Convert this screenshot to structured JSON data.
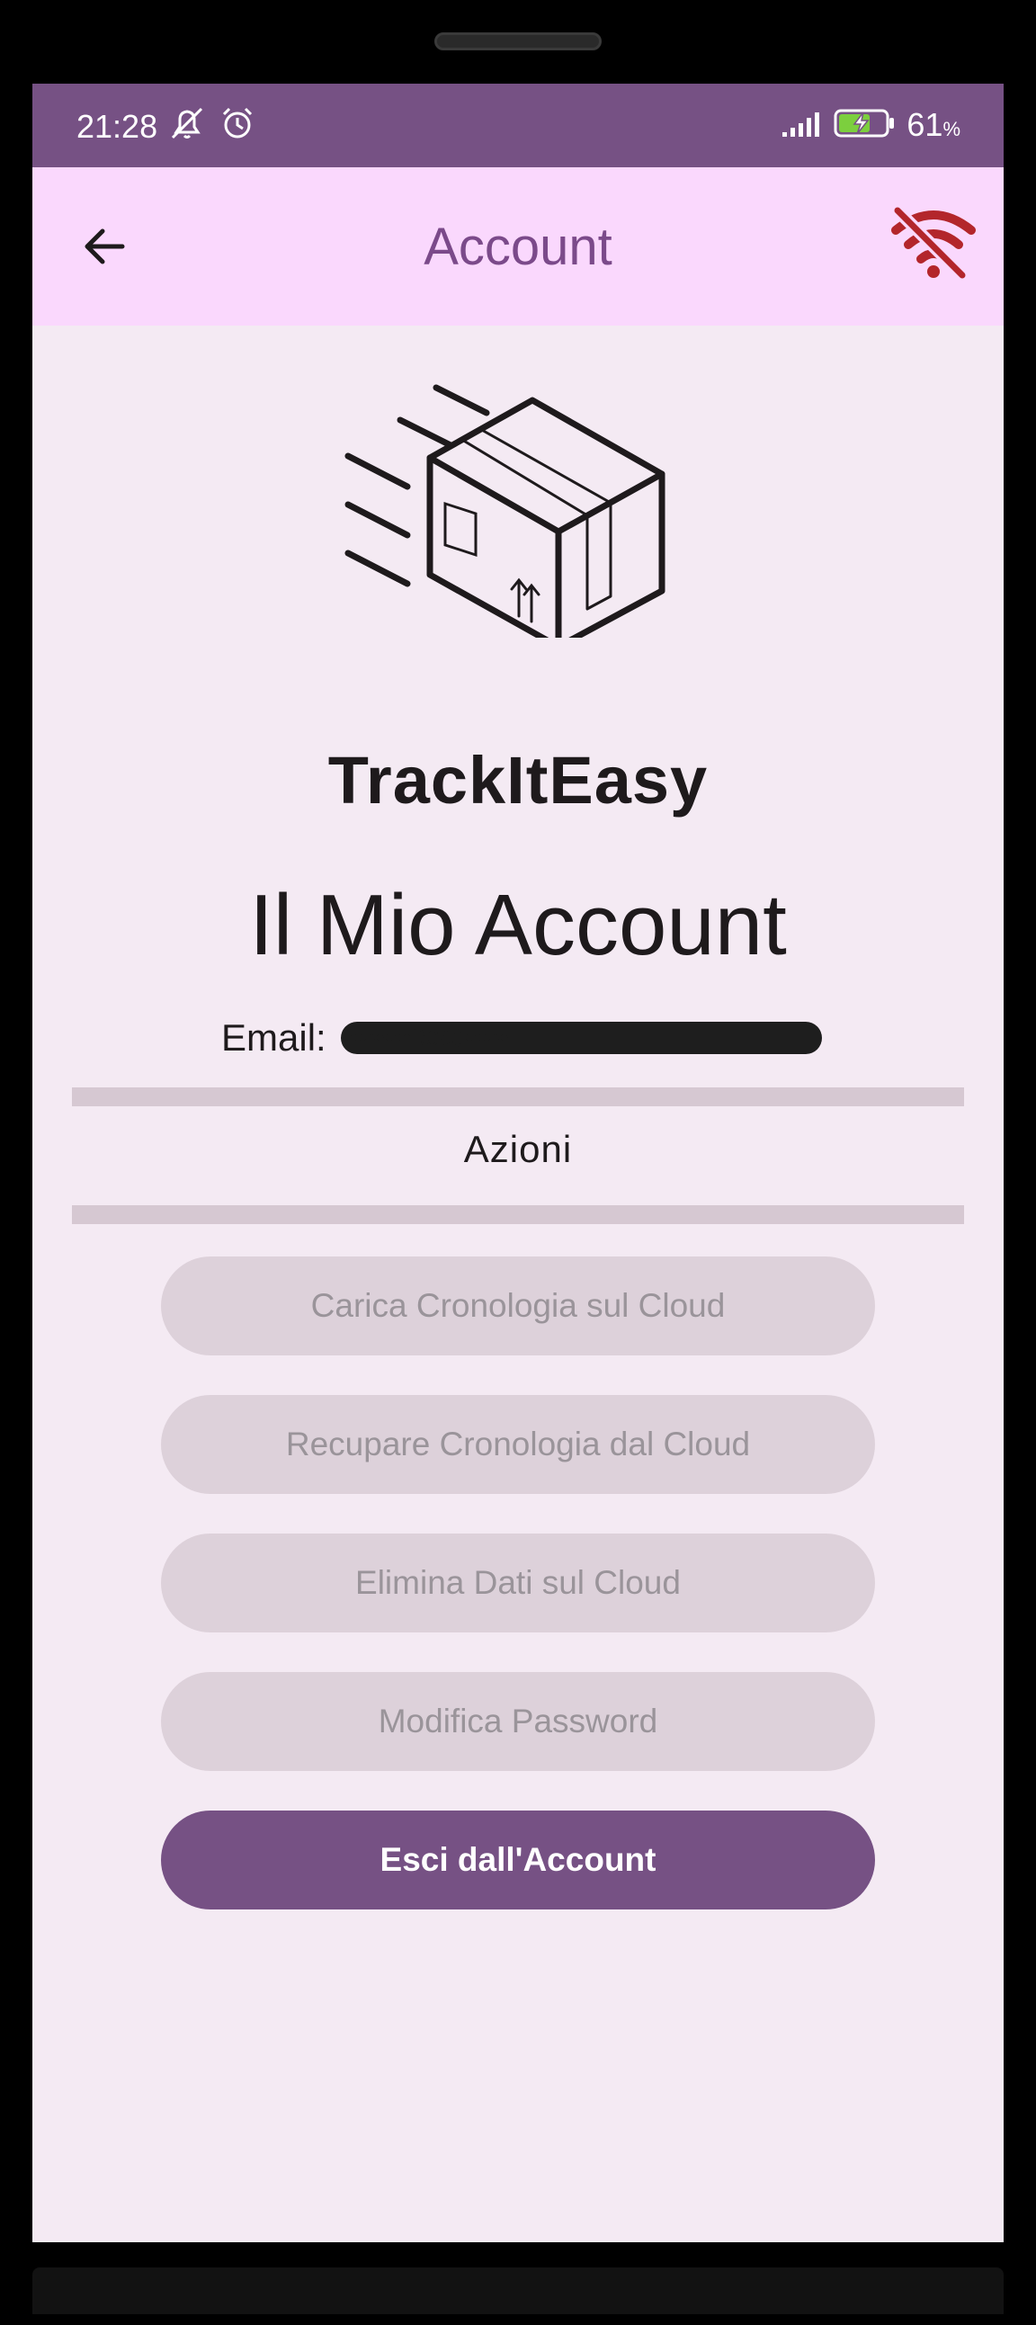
{
  "status_bar": {
    "time": "21:28",
    "battery_percent": "61",
    "battery_unit": "%",
    "icons": [
      "mute-icon",
      "alarm-icon",
      "signal-icon",
      "battery-charging-icon"
    ]
  },
  "app_bar": {
    "title": "Account",
    "back_icon": "arrow-left-icon",
    "status_icon": "wifi-off-icon"
  },
  "logo": {
    "brand": "TrackItEasy",
    "icon": "delivery-box-icon"
  },
  "page": {
    "title": "Il Mio Account",
    "email_label": "Email:",
    "email_value": "••••••••00@•••••"
  },
  "section": {
    "label": "Azioni"
  },
  "actions": [
    {
      "label": "Carica Cronologia sul Cloud",
      "enabled": false
    },
    {
      "label": "Recupare Cronologia dal Cloud",
      "enabled": false
    },
    {
      "label": "Elimina Dati sul Cloud",
      "enabled": false
    },
    {
      "label": "Modifica Password",
      "enabled": false
    },
    {
      "label": "Esci dall'Account",
      "enabled": true
    }
  ],
  "colors": {
    "primary": "#765184",
    "app_bar_bg": "#fad8fd",
    "screen_bg": "#f4eaf3",
    "disabled_button_bg": "#ddd1da",
    "wifi_off_red": "#b3262b"
  }
}
